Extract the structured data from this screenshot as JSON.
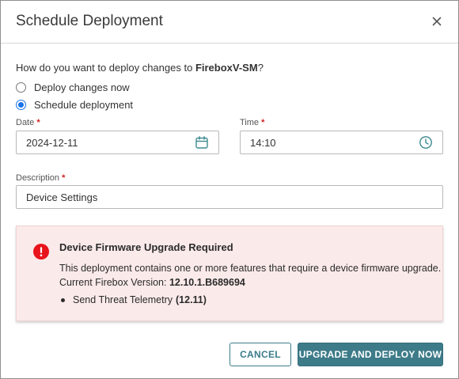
{
  "dialog": {
    "title": "Schedule Deployment",
    "question_prefix": "How do you want to deploy changes to ",
    "device_name": "FireboxV-SM",
    "question_suffix": "?"
  },
  "deploy_options": [
    {
      "label": "Deploy changes now",
      "selected": false
    },
    {
      "label": "Schedule deployment",
      "selected": true
    }
  ],
  "fields": {
    "date": {
      "label": "Date",
      "required_mark": "*",
      "value": "2024-12-11",
      "icon": "calendar-icon"
    },
    "time": {
      "label": "Time",
      "required_mark": "*",
      "value": "14:10",
      "icon": "clock-icon"
    },
    "description": {
      "label": "Description",
      "required_mark": "*",
      "value": "Device Settings"
    }
  },
  "alert": {
    "icon": "error-icon",
    "title": "Device Firmware Upgrade Required",
    "message": "This deployment contains one or more features that require a device firmware upgrade.",
    "version_label": "Current Firebox Version: ",
    "version_value": "12.10.1.B689694",
    "features": [
      {
        "name": "Send Threat Telemetry",
        "version": "(12.11)"
      }
    ]
  },
  "buttons": {
    "cancel": "CANCEL",
    "primary": "UPGRADE AND DEPLOY NOW"
  },
  "colors": {
    "accent": "#3d7b89",
    "radio": "#1a73e8",
    "error": "#e8141c",
    "alert_bg": "#fbeaea",
    "icon_teal": "#3d8a8f"
  }
}
